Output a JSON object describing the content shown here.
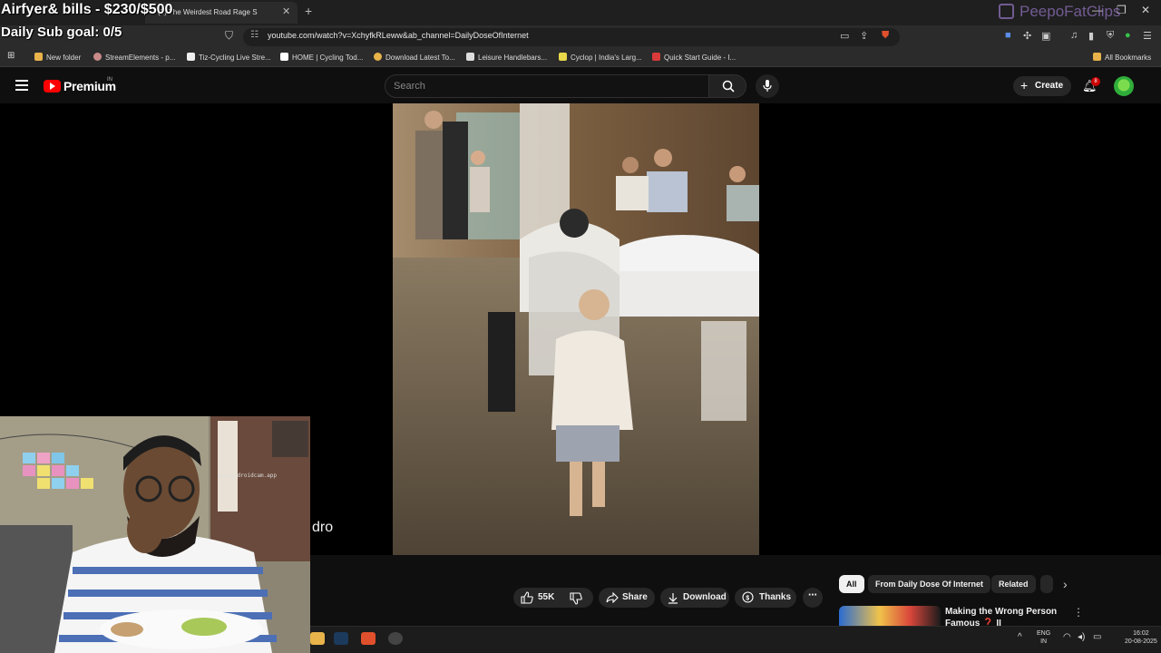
{
  "browser": {
    "tab_title": "(3) The Weirdest Road Rage S",
    "new_tab_glyph": "+",
    "url": "youtube.com/watch?v=XchyfkRLeww&ab_channel=DailyDoseOfInternet",
    "bookmarks": [
      {
        "label": "New folder",
        "color": "#e8b34a"
      },
      {
        "label": "StreamElements - p...",
        "color": "#c98a8a"
      },
      {
        "label": "Tiz-Cycling Live Stre...",
        "color": "#eeeeee"
      },
      {
        "label": "HOME | Cycling Tod...",
        "color": "#ffffff"
      },
      {
        "label": "Download Latest To...",
        "color": "#e8b34a"
      },
      {
        "label": "Leisure Handlebars...",
        "color": "#dddddd"
      },
      {
        "label": "Cyclop | India's Larg...",
        "color": "#e8d84a"
      },
      {
        "label": "Quick Start Guide - I...",
        "color": "#d93a3a"
      }
    ],
    "all_bookmarks": "All Bookmarks"
  },
  "youtube": {
    "brand": "Premium",
    "region": "IN",
    "search_placeholder": "Search",
    "create_label": "Create",
    "notification_count": "8",
    "actions": {
      "likes": "55K",
      "share": "Share",
      "download": "Download",
      "thanks": "Thanks",
      "more": "⋯"
    },
    "chips": [
      "All",
      "From Daily Dose Of Internet",
      "Related"
    ],
    "recommendation_title": "Making the Wrong Person Famous ❓ II"
  },
  "overlay": {
    "goal_line": "Airfyer& bills - $230/$500",
    "sub_goal": "Daily Sub goal: 0/5",
    "watermark": "PeepoFatClips",
    "webcam_caption": "dro",
    "webcam_tag": "using droidcam.app"
  },
  "taskbar": {
    "lang_line1": "ENG",
    "lang_line2": "IN",
    "time": "16:02",
    "date": "20-08-2025"
  },
  "colors": {
    "yt_red": "#ff0000",
    "bg": "#0f0f0f",
    "watermark": "#b48cf0"
  }
}
